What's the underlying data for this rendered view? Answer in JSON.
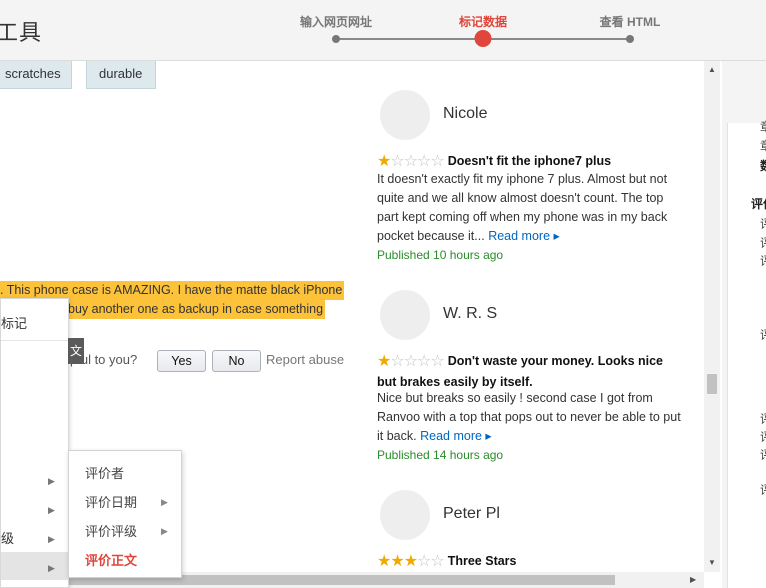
{
  "header": {
    "app_title": "工具",
    "steps": [
      {
        "label": "输入网页网址"
      },
      {
        "label": "标记数据"
      },
      {
        "label": "查看 HTML"
      }
    ],
    "active_step": 1
  },
  "tags": [
    "scratches",
    "durable"
  ],
  "highlighted_lines": [
    ". This phone case is AMAZING. I have the matte black iPhone",
    "buy another one as backup in case something"
  ],
  "helpful": {
    "question": "pful to you?",
    "yes_label": "Yes",
    "no_label": "No",
    "report_label": "Report abuse"
  },
  "reviews": [
    {
      "name": "Nicole",
      "rating": 1,
      "title": "Doesn't fit the iphone7 plus",
      "body": "It doesn't exactly fit my iphone 7 plus. Almost but not quite and we all know almost doesn't count. The top part kept coming off when my phone was in my back pocket because it...",
      "read_more": "Read more ▸",
      "published": "Published 10 hours ago"
    },
    {
      "name": "W. R. S",
      "rating": 1,
      "title": "Don't waste your money. Looks nice but brakes easily by itself.",
      "body": "Nice but breaks so easily ! second case I got from Ranvoo with a top that pops out to never be able to put it back.",
      "read_more": "Read more ▸",
      "published": "Published 14 hours ago"
    },
    {
      "name": "Peter Pl",
      "rating": 3,
      "title": "Three Stars"
    }
  ],
  "context_menu": {
    "first_item": "标记",
    "chip": "文",
    "partial_item": "级"
  },
  "submenu": {
    "items": [
      {
        "label": "评价者",
        "has_arrow": false
      },
      {
        "label": "评价日期",
        "has_arrow": true
      },
      {
        "label": "评价评级",
        "has_arrow": true
      },
      {
        "label": "评价正文",
        "has_arrow": false,
        "active": true
      }
    ]
  },
  "right_panel": {
    "lines": [
      "章",
      "章",
      "数",
      "评价",
      "评",
      "评",
      "评",
      "评",
      "评",
      "评",
      "评",
      "评"
    ]
  },
  "colors": {
    "accent": "#e0463b",
    "highlight": "#fcc23a",
    "link": "#0066c0",
    "published": "#2a8c2a",
    "star": "#f0ab00"
  }
}
